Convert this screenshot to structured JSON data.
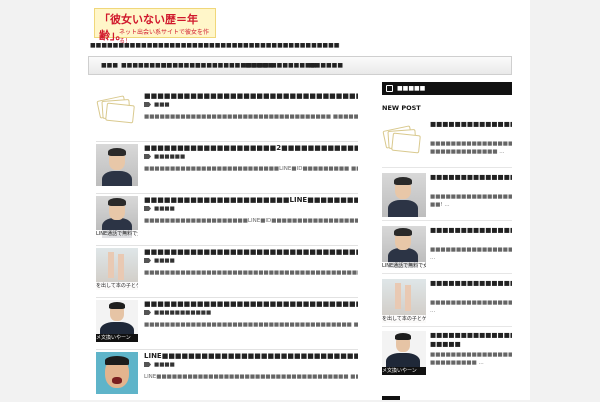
{
  "header": {
    "logo_line1": "「彼女いない歴＝年齢」。",
    "logo_line2": "ネット出会い系サイトで彼女を作る！",
    "tagline": "■■■■■■■■■■■■■■■■■■■■■■■■■■■■■■■■■■■■■■■■■■■■■■■■■■■■■■■■■■■■"
  },
  "nav": {
    "items": [
      "■■■",
      "■■■■■■■■■",
      "■■■■■■■",
      "■■■■■■■■■■■■■",
      "■■■■■",
      "■■■■■■■■",
      "■■■■■■"
    ]
  },
  "posts": [
    {
      "title": "■■■■■■■■■■■■■■■■■■■■■■■■■■■■■■■■■■■■■■■■",
      "category": "■■■",
      "excerpt": "■■■■■■■■■■■■■■■■■■■■■■■■■■■■■■■■■■■■ ■■■■■■■■■■■■■■■■ ..."
    },
    {
      "title": "■■■■■■■■■■■■■■■■■■■■2■■■■■■■■■■■■■■■■■■■",
      "category": "■■■■■■",
      "excerpt": "■■■■■■■■■■■■■■■■■■■■■■■■■■LINE■ID■■■■■■■■■ ■■! ..."
    },
    {
      "title": "■■■■■■■■■■■■■■■■■■■■■■LINE■■■■■■■■■■■■■■■■■",
      "category": "■■■■",
      "excerpt": "■■■■■■■■■■■■■■■■■■■■LINE■ID■■■■■■■■■■■■■■■■■■■■■■■■■■■ ..."
    },
    {
      "title": "■■■■■■■■■■■■■■■■■■■■■■■■■■■■■■■■■■■■■■■■■■",
      "category": "■■■■",
      "excerpt": "■■■■■■■■■■■■■■■■■■■■■■■■■■■■■■■■■■■■■■■■■■■■■■■ ■■■ ..."
    },
    {
      "title": "■■■■■■■■■■■■■■■■■■■■■■■■■■■■■■■■■■■…■■■■■■",
      "category": "■■■■■■■■■■■",
      "excerpt": "■■■■■■■■■■■■■■■■■■■■■■■■■■■■■■■■■■■■■■■■ ■■■■■■■■■ ..."
    },
    {
      "title": "LINE■■■■■■■■■■■■■■■■■■■■■■■■■■■■■■■■■■",
      "category": "■■■■",
      "excerpt": "LINE■■■■■■■■■■■■■■■■■■■■■■■■■■■■■■■■■■■■■ ■■■LINE ..."
    }
  ],
  "sidebar": {
    "rss_title": "■■■■■",
    "new_post_label": "NEW POST",
    "items": [
      {
        "title": "■■■■■■■■■■■■■■■■■■■■■■■■■■■■■■■■■■■",
        "excerpt": "■■■■■■■■■■■■■■■■■■■■■■■■■■■■■ ■■■■■■■■■■■■■ ..."
      },
      {
        "title": "■■■■■■■■■■■■■■■■2■■■■■■■■■■■■■■■■■",
        "excerpt": "■■■■■■■■■■■■■■■■■■■■■■■■■■LINE■ID■■■■■■■■■ ■■! ..."
      },
      {
        "title": "■■■■■■■■■■■■■■■■■■■■LINE■■■■■■■■■■■■■■■■■",
        "excerpt": "■■■■■■■■■■■■■■■■■■■■LINE■ID■■■■■■■■■■■■■■■■■■■■■■■■■■■ ..."
      },
      {
        "title": "■■■■■■■■■■■■■■■■■■■■■■■■■■■■■■■■■■■■",
        "excerpt": "■■■■■■■■■■■■■■■■■■■■■■■■■■■■■■■■■■■■■■■■■■■■■ ..."
      },
      {
        "title": "■■■■■■■■■■■■■■■■■■■■■■■■■■■■…■■■■■",
        "excerpt": "■■■■■■■■■■■■■■■■■■■■■■■■■■■■■■■■ ■■■■■■■■■ ..."
      }
    ]
  },
  "thumb_captions": {
    "phone": "LINE通話で無料で女性をゲット",
    "legs": "を出して本の子とゲ",
    "dark": "メ文換いやーン"
  }
}
